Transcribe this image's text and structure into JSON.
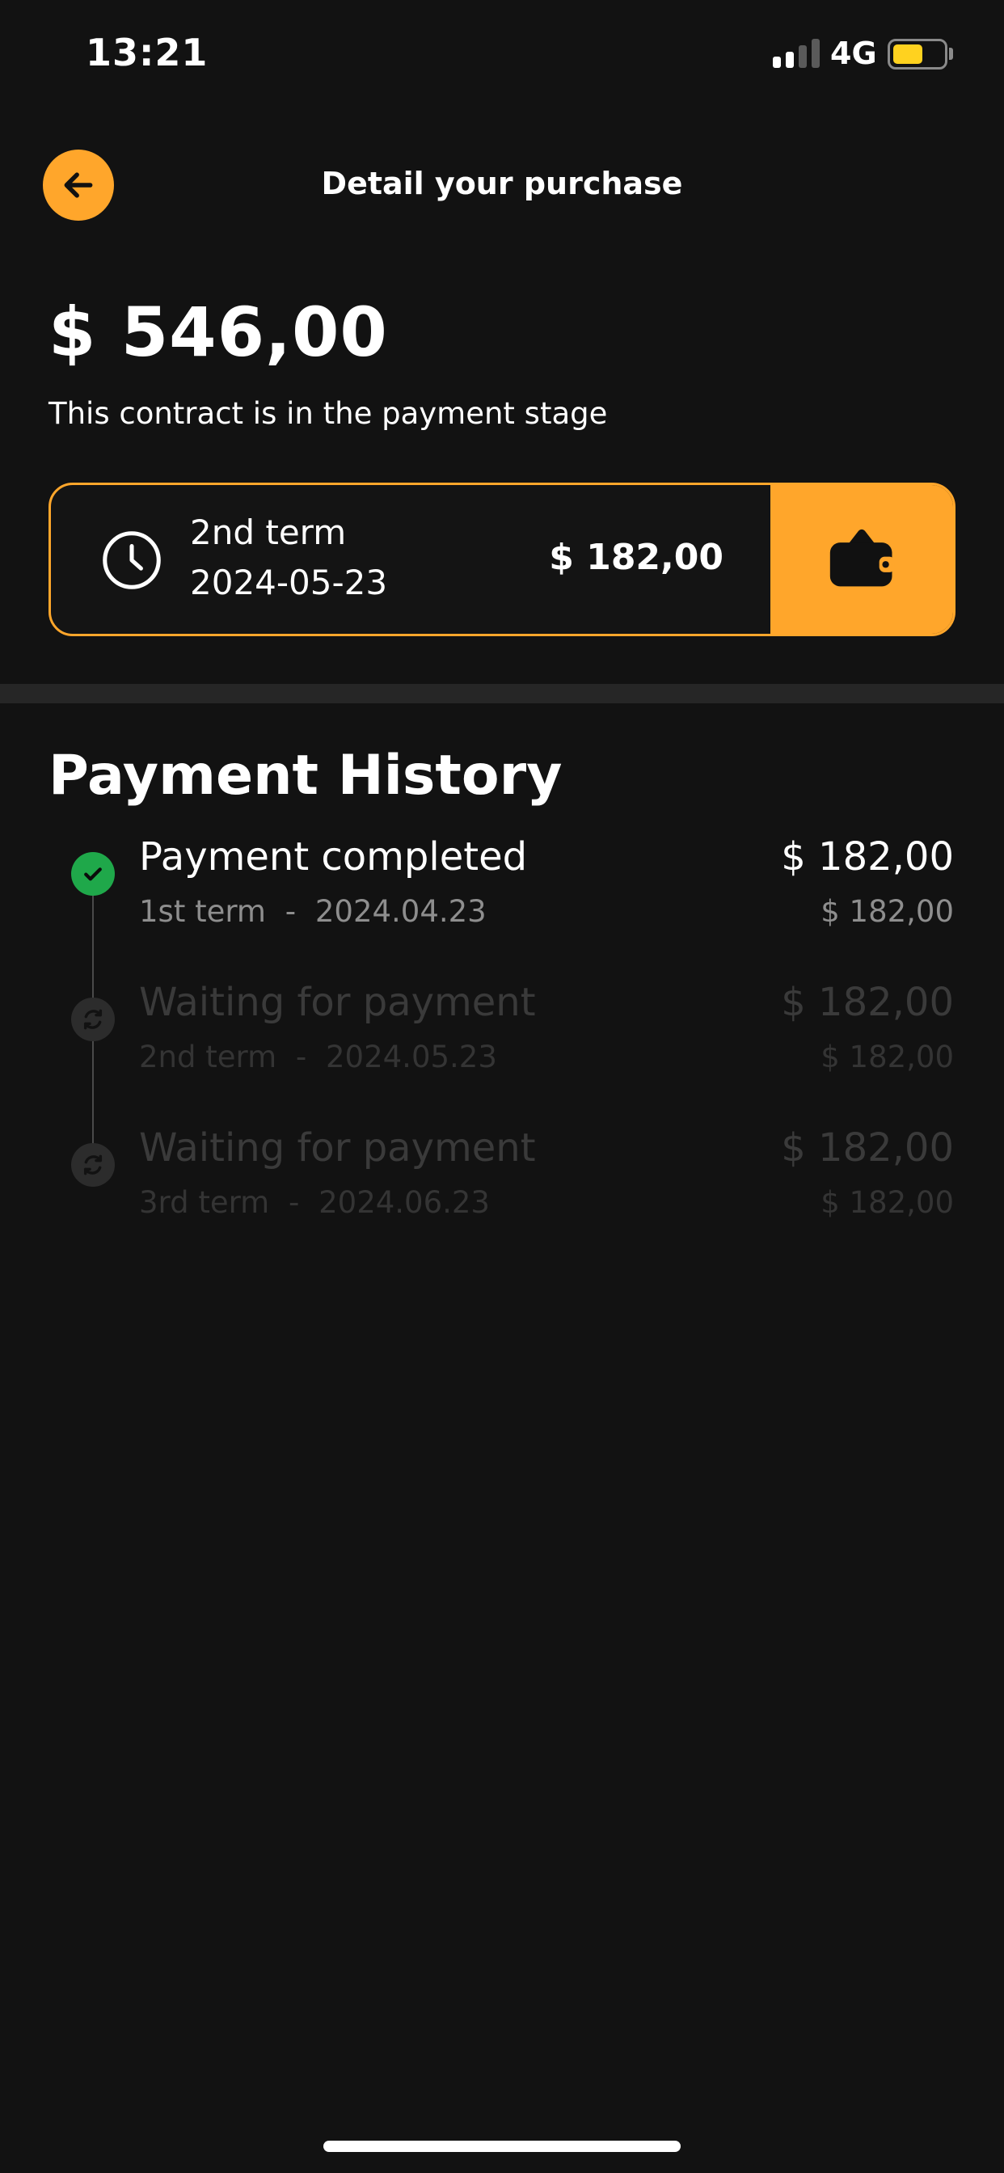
{
  "status_bar": {
    "time": "13:21",
    "network": "4G"
  },
  "header": {
    "title": "Detail your purchase",
    "back_icon": "arrow-left-icon"
  },
  "summary": {
    "total": "$ 546,00",
    "status_text": "This contract is in the payment stage"
  },
  "current_term": {
    "name": "2nd term",
    "due_date": "2024-05-23",
    "amount": "$ 182,00",
    "icon": "clock-icon",
    "pay_icon": "wallet-icon"
  },
  "history": {
    "title": "Payment History",
    "items": [
      {
        "title": "Payment completed",
        "term": "1st term",
        "date": "2024.04.23",
        "amount": "$ 182,00",
        "sub_amount": "$ 182,00",
        "state": "completed"
      },
      {
        "title": "Waiting for payment",
        "term": "2nd term",
        "date": "2024.05.23",
        "amount": "$ 182,00",
        "sub_amount": "$ 182,00",
        "state": "pending"
      },
      {
        "title": "Waiting for payment",
        "term": "3rd term",
        "date": "2024.06.23",
        "amount": "$ 182,00",
        "sub_amount": "$ 182,00",
        "state": "pending"
      }
    ],
    "separator": "-"
  },
  "colors": {
    "accent": "#ffa62b",
    "success": "#1fa84a",
    "background": "#121212"
  }
}
